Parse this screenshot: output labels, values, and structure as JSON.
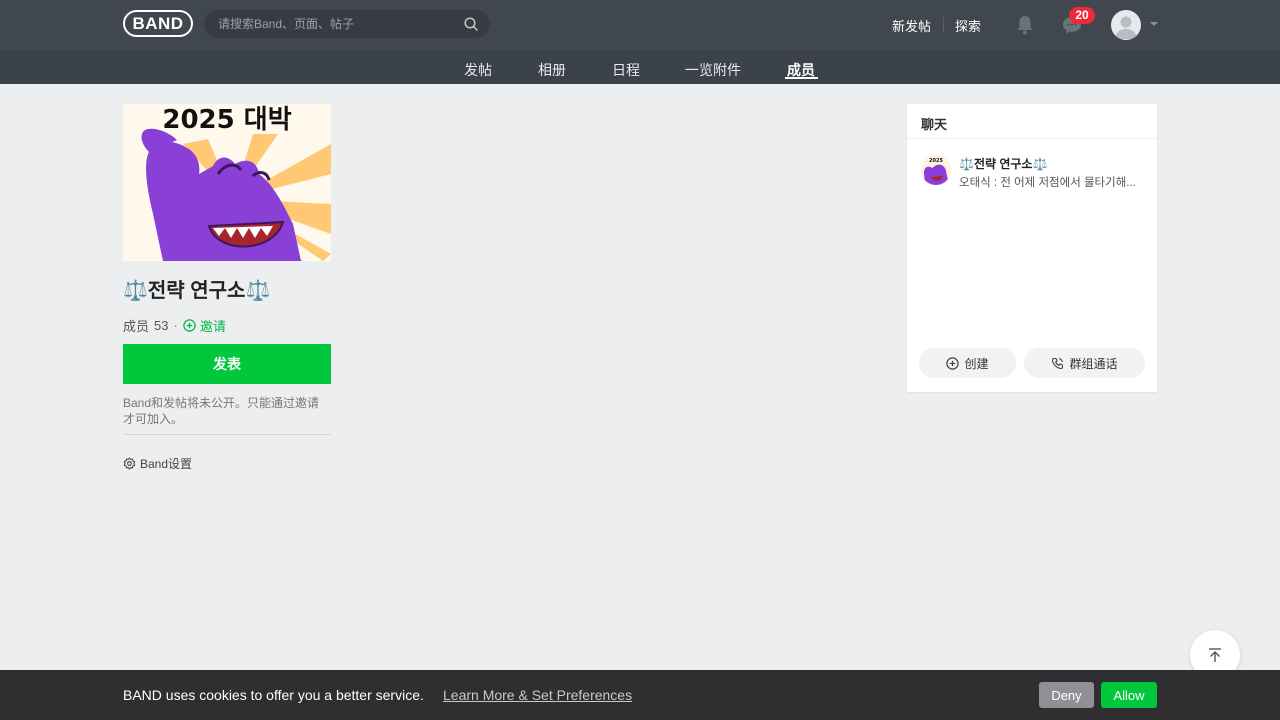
{
  "header": {
    "logo": "BAND",
    "search_placeholder": "请搜索Band、页面、帖子",
    "new_post": "新发帖",
    "explore": "探索",
    "chat_badge": "20",
    "colors": {
      "bar": "#41474f",
      "badge": "#f0283c"
    },
    "icons": [
      "search-icon",
      "bell-icon",
      "chat-icon",
      "avatar-icon",
      "caret-down-icon"
    ]
  },
  "tabs": [
    {
      "label": "发帖"
    },
    {
      "label": "相册"
    },
    {
      "label": "日程"
    },
    {
      "label": "一览附件"
    },
    {
      "label": "成员",
      "active": true
    }
  ],
  "band": {
    "cover_text": "2025 대박",
    "name": "⚖️전략 연구소⚖️",
    "members_label": "成员",
    "members_count": "53",
    "dot": "·",
    "invite": "邀请",
    "post_button": "发表",
    "privacy_note": "Band和发帖将未公开。只能通过邀请才可加入。",
    "settings": "Band设置",
    "accent_color": "#00c73c"
  },
  "chat": {
    "title": "聊天",
    "room_name": "⚖️전략 연구소⚖️",
    "room_preview": "오태식 : 전 어제 저점에서 물타기해...",
    "create": "创建",
    "group_call": "群组通话"
  },
  "cookie": {
    "text": "BAND uses cookies to offer you a better service.",
    "link": "Learn More & Set Preferences",
    "deny": "Deny",
    "allow": "Allow"
  }
}
